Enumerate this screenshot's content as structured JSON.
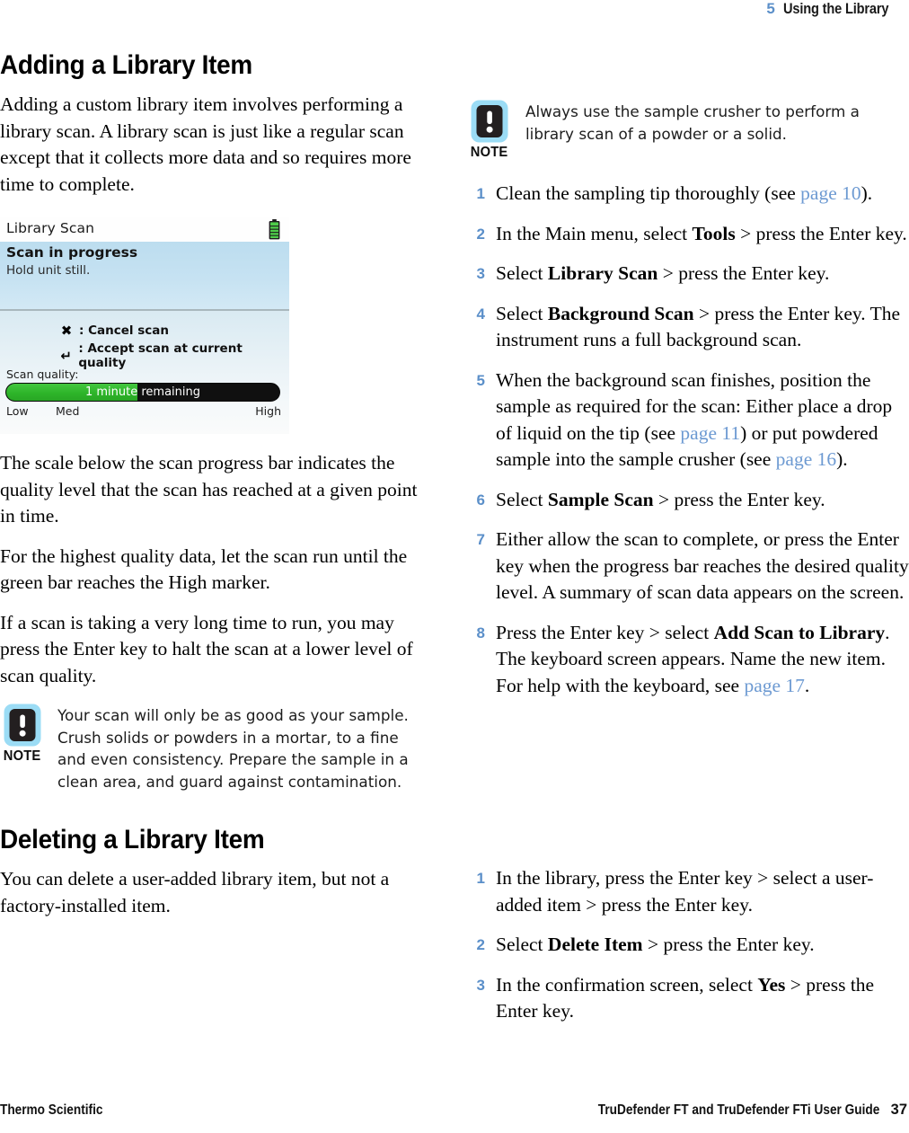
{
  "header": {
    "chapter_number": "5",
    "chapter_title": "Using the Library"
  },
  "left_column": {
    "heading": "Adding a Library Item",
    "intro_paragraph": "Adding a custom library item involves performing a library scan. A library scan is just like a regular scan except that it collects more data and so requires more time to complete.",
    "paragraphs": [
      "The scale below the scan progress bar indicates the quality level that the scan has reached at a given point in time.",
      "For the highest quality data, let the scan run until the green bar reaches the High marker.",
      "If a scan is taking a very long time to run, you may press the Enter key to halt the scan at a lower level of scan quality."
    ],
    "note": {
      "label": "NOTE",
      "icon": "exclamation-note-icon",
      "text": "Your scan will only be as good as your sample. Crush solids or powders in a mortar, to a fine and even consistency. Prepare the sample in a clean area, and guard against contamination."
    }
  },
  "device_screenshot": {
    "title": "Library Scan",
    "battery_icon": "battery-full-icon",
    "banner_title": "Scan in progress",
    "banner_subtitle": "Hold unit still.",
    "keys": [
      {
        "glyph": "✖",
        "icon": "x-cancel-icon",
        "label": ": Cancel scan"
      },
      {
        "glyph": "↵",
        "icon": "enter-key-icon",
        "label": ": Accept scan at current quality"
      }
    ],
    "quality_label": "Scan quality:",
    "progress_text": "1 minute remaining",
    "progress_percent": 48,
    "scale": {
      "low": "Low",
      "med": "Med",
      "high": "High"
    },
    "colors": {
      "bar_fill": "#2eb52a",
      "bar_track": "#101010",
      "banner": "#c6e2f2"
    }
  },
  "right_column": {
    "note": {
      "label": "NOTE",
      "icon": "exclamation-note-icon",
      "text": "Always use the sample crusher to perform a library scan of a powder or a solid."
    },
    "steps": [
      {
        "num": "1",
        "html": "Clean the sampling tip thoroughly (see <span class=\"xref\">page 10</span>)."
      },
      {
        "num": "2",
        "html": "In the Main menu, select <b class=\"cmd\">Tools</b> &gt; press the Enter key."
      },
      {
        "num": "3",
        "html": "Select <b class=\"cmd\">Library Scan</b> &gt; press the Enter key."
      },
      {
        "num": "4",
        "html": "Select <b class=\"cmd\">Background Scan</b> &gt; press the Enter key. The instrument runs a full background scan."
      },
      {
        "num": "5",
        "html": "When the background scan finishes, position the sample as required for the scan: Either place a drop of liquid on the tip (see <span class=\"xref\">page 11</span>) or put powdered sample into the sample crusher (see <span class=\"xref\">page 16</span>)."
      },
      {
        "num": "6",
        "html": "Select <b class=\"cmd\">Sample Scan</b> &gt; press the Enter key."
      },
      {
        "num": "7",
        "html": "Either allow the scan to complete, or press the Enter key when the progress bar reaches the desired quality level. A summary of scan data appears on the screen."
      },
      {
        "num": "8",
        "html": "Press the Enter key &gt; select <b class=\"cmd\">Add Scan to Library</b>. The keyboard screen appears. Name the new item. For help with the keyboard, see <span class=\"xref\">page 17</span>."
      }
    ]
  },
  "lower_left": {
    "heading": "Deleting a Library Item",
    "paragraph": "You can delete a user-added library item, but not a factory-installed item."
  },
  "lower_right": {
    "steps": [
      {
        "num": "1",
        "html": "In the library, press the Enter key &gt; select a user-added item &gt; press the Enter key."
      },
      {
        "num": "2",
        "html": "Select <b class=\"cmd\">Delete Item</b> &gt; press the Enter key."
      },
      {
        "num": "3",
        "html": "In the confirmation screen, select <b class=\"cmd\">Yes</b> &gt; press the Enter key."
      }
    ]
  },
  "footer": {
    "left": "Thermo Scientific",
    "guide": "TruDefender FT and TruDefender FTi User Guide",
    "page_number": "37"
  },
  "colors": {
    "accent_blue": "#5b8fc9",
    "xref_blue": "#6d9ad2",
    "note_ring": "#9bdcf5",
    "note_body": "#231f20"
  }
}
